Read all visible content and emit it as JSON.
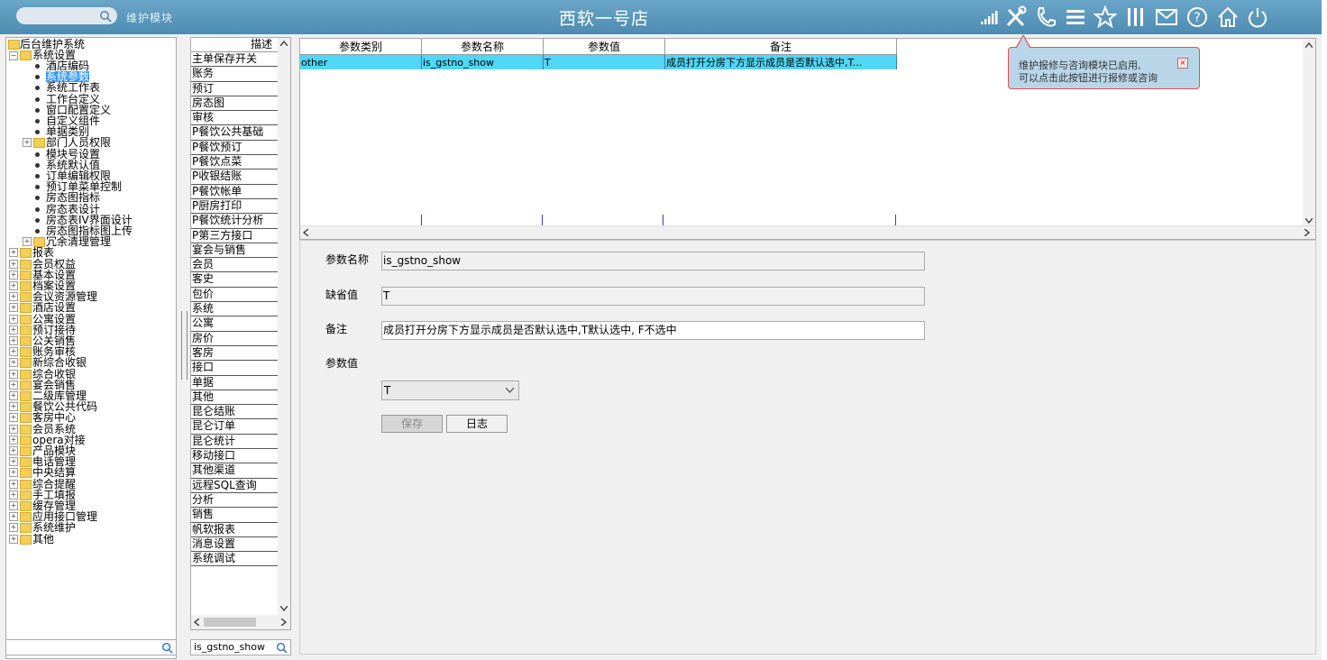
{
  "topbar": {
    "search_hint": "维护模块",
    "title": "西软一号店",
    "icons": [
      "signal-icon",
      "tools-icon",
      "phone-icon",
      "menu-icon",
      "star-icon",
      "columns-icon",
      "mail-icon",
      "help-icon",
      "home-icon",
      "power-icon"
    ]
  },
  "tooltip": {
    "line1": "维护报修与咨询模块已启用,",
    "line2": "可以点击此按钮进行报修或咨询"
  },
  "tree": {
    "root": "后台维护系统",
    "system_settings": "系统设置",
    "children": [
      "酒店编码",
      "系统参数",
      "系统工作表",
      "工作台定义",
      "窗口配置定义",
      "自定义组件",
      "单据类别"
    ],
    "dept": "部门人员权限",
    "children2": [
      "模块号设置",
      "系统默认值",
      "订单编辑权限",
      "预订单菜单控制",
      "房态图指标",
      "房态表设计",
      "房态表IV界面设计",
      "房态图指标图上传"
    ],
    "redundant": "冗余清理管理",
    "top_items": [
      "报表",
      "会员权益",
      "基本设置",
      "档案设置",
      "会议资源管理",
      "酒店设置",
      "公寓设置",
      "预订接待",
      "公关销售",
      "账务审核",
      "新综合收银",
      "综合收银",
      "宴会销售",
      "二级库管理",
      "餐饮公共代码",
      "客房中心",
      "会员系统",
      "opera对接",
      "产品模块",
      "电话管理",
      "中央结算",
      "综合提醒",
      "手工填报",
      "缓存管理",
      "应用接口管理",
      "系统维护",
      "其他"
    ]
  },
  "desc_list": {
    "header": "描述",
    "items": [
      "主单保存开关",
      "账务",
      "预订",
      "房态图",
      "审核",
      "P餐饮公共基础",
      "P餐饮预订",
      "P餐饮点菜",
      "P收银结账",
      "P餐饮帐单",
      "P厨房打印",
      "P餐饮统计分析",
      "P第三方接口",
      "宴会与销售",
      "会员",
      "客史",
      "包价",
      "系统",
      "公寓",
      "房价",
      "客房",
      "接口",
      "单据",
      "其他",
      "昆仑结账",
      "昆仑订单",
      "昆仑统计",
      "移动接口",
      "其他渠道",
      "远程SQL查询",
      "分析",
      "销售",
      "帆软报表",
      "消息设置",
      "系统调试"
    ],
    "search_value": "is_gstno_show"
  },
  "grid": {
    "headers": [
      "参数类别",
      "参数名称",
      "参数值",
      "备注"
    ],
    "row": [
      "other",
      "is_gstno_show",
      "T",
      "成员打开分房下方显示成员是否默认选中,T..."
    ]
  },
  "form": {
    "param_name_label": "参数名称",
    "param_name_value": "is_gstno_show",
    "default_label": "缺省值",
    "default_value": "T",
    "remark_label": "备注",
    "remark_value": "成员打开分房下方显示成员是否默认选中,T默认选中, F不选中",
    "param_value_label": "参数值",
    "param_value_selected": "T",
    "save_label": "保存",
    "log_label": "日志"
  }
}
